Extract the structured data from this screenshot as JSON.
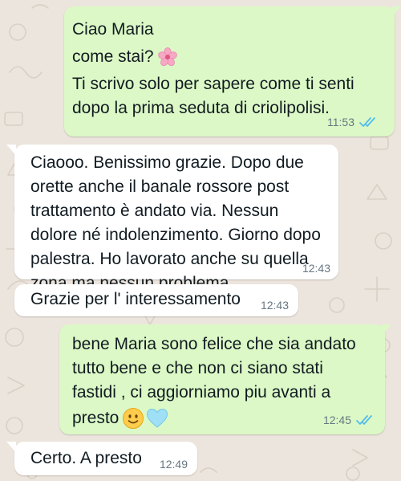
{
  "messages": [
    {
      "direction": "outgoing",
      "lines": [
        "Ciao Maria",
        "come stai?",
        "Ti scrivo solo per sapere come ti senti",
        "dopo la prima seduta di criolipolisi."
      ],
      "emoji_after_line_2": "cherry-blossom",
      "time": "11:53",
      "read": true
    },
    {
      "direction": "incoming",
      "lines": [
        "Ciaooo. Benissimo grazie. Dopo due",
        "orette anche il banale rossore post",
        "trattamento è andato via. Nessun",
        "dolore né indolenzimento. Giorno dopo",
        "palestra. Ho lavorato anche su quella",
        "zona ma nessun problema."
      ],
      "time": "12:43"
    },
    {
      "direction": "incoming",
      "lines": [
        "Grazie per l' interessamento"
      ],
      "time": "12:43"
    },
    {
      "direction": "outgoing",
      "lines": [
        "bene Maria sono felice che sia andato",
        "tutto bene e che non ci siano stati",
        "fastidi , ci aggiorniamo piu avanti a",
        "presto"
      ],
      "emoji_after_last_line": [
        "slightly-smiling-face",
        "light-blue-heart"
      ],
      "time": "12:45",
      "read": true
    },
    {
      "direction": "incoming",
      "lines": [
        "Certo. A presto"
      ],
      "time": "12:49"
    }
  ],
  "colors": {
    "wallpaper": "#ece5dd",
    "outgoing_bubble": "#dcf8c6",
    "incoming_bubble": "#ffffff",
    "text": "#111b21",
    "meta": "#667781",
    "read_ticks": "#53bdeb"
  }
}
